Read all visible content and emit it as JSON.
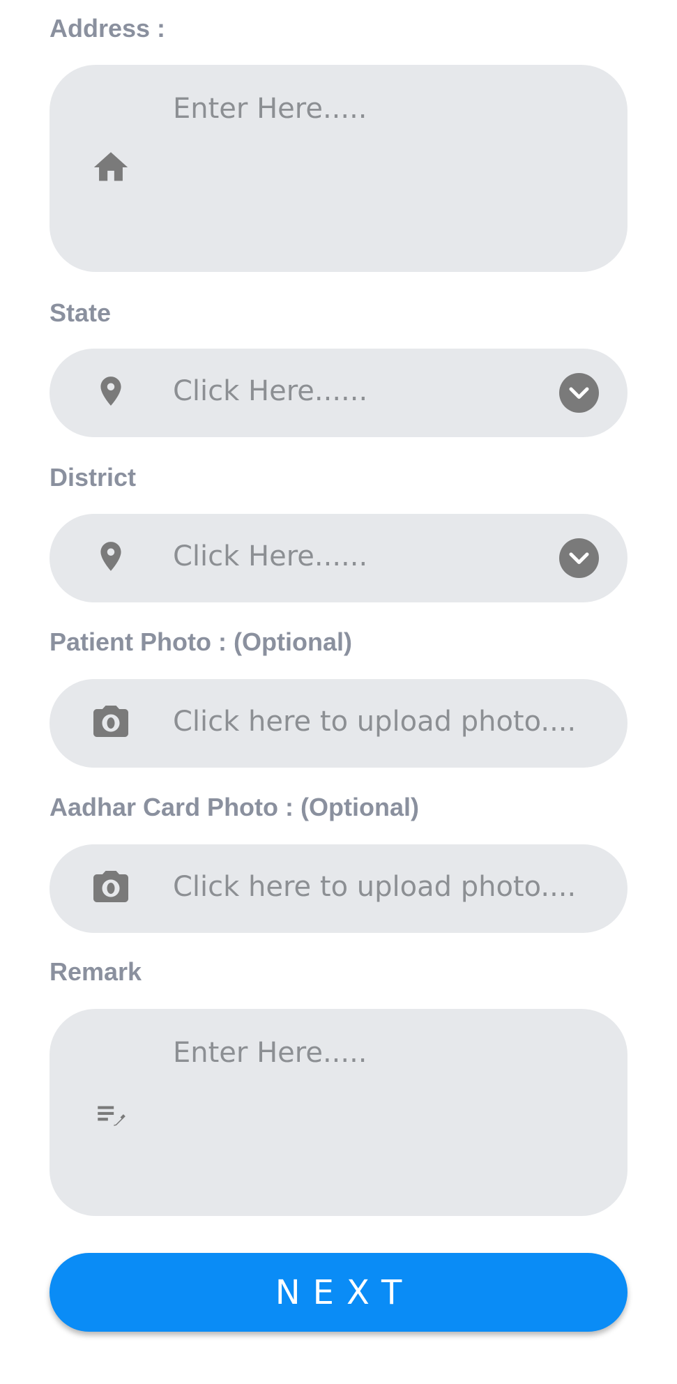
{
  "form": {
    "address": {
      "label": "Address :",
      "placeholder": "Enter Here....."
    },
    "state": {
      "label": "State",
      "placeholder": "Click Here......"
    },
    "district": {
      "label": "District",
      "placeholder": "Click Here......"
    },
    "patient_photo": {
      "label": "Patient Photo : (Optional)",
      "placeholder": "Click here to upload photo...."
    },
    "aadhar_photo": {
      "label": "Aadhar Card Photo : (Optional)",
      "placeholder": "Click here to upload photo...."
    },
    "remark": {
      "label": "Remark",
      "placeholder": "Enter Here....."
    }
  },
  "next_button": {
    "label": "NEXT"
  },
  "icons": {
    "address": "home-icon",
    "state": "location-pin-icon",
    "district": "location-pin-icon",
    "patient_photo": "camera-icon",
    "aadhar_photo": "camera-icon",
    "remark": "edit-notes-icon",
    "dropdown": "chevron-down-icon"
  },
  "colors": {
    "field_bg": "#e6e8eb",
    "label_text": "#8a909e",
    "placeholder_text": "#8c8f93",
    "icon": "#7a7a7a",
    "button_bg": "#0a8cf6",
    "button_text": "#ffffff"
  }
}
